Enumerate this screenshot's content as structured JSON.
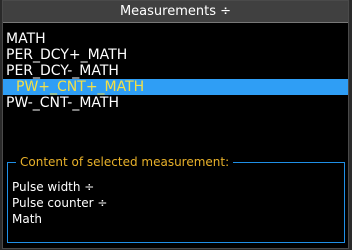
{
  "window": {
    "title": "Measurements ÷"
  },
  "list": {
    "items": [
      {
        "label": "MATH",
        "selected": false
      },
      {
        "label": "PER_DCY+_MATH",
        "selected": false
      },
      {
        "label": "PER_DCY-_MATH",
        "selected": false
      },
      {
        "label": "PW+_CNT+_MATH",
        "selected": true
      },
      {
        "label": "PW-_CNT-_MATH",
        "selected": false
      }
    ]
  },
  "content_group": {
    "title": "Content of selected measurement:",
    "items": [
      "Pulse width ÷",
      "Pulse counter ÷",
      "Math"
    ]
  },
  "colors": {
    "selection_background": "#2f9ef5",
    "selection_text": "#f4e046",
    "group_border": "#1f8fe6",
    "group_title": "#e8b12a"
  }
}
